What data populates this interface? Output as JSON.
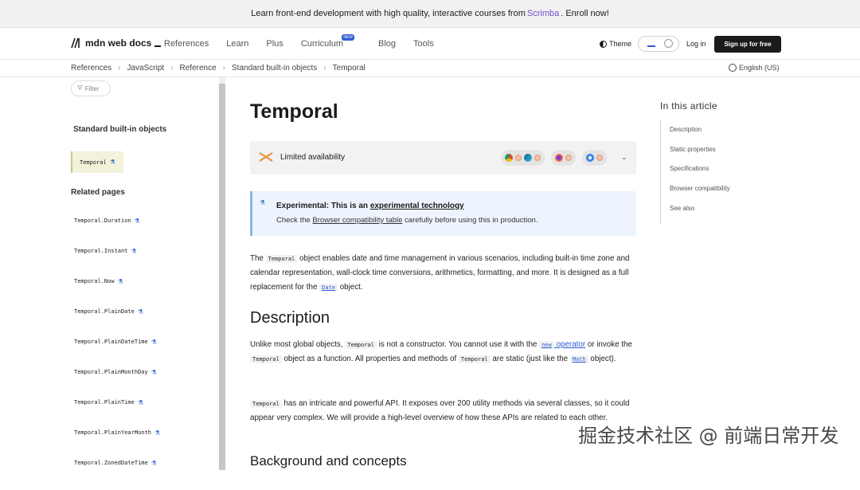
{
  "banner": {
    "text_before": "Learn front-end development with high quality, interactive courses from",
    "link": "Scrimba",
    "text_after": ". Enroll now!"
  },
  "header": {
    "logo": "mdn web docs",
    "nav": [
      "References",
      "Learn",
      "Plus",
      "Curriculum",
      "Blog",
      "Tools"
    ],
    "new_badge": "NEW",
    "theme": "Theme",
    "login": "Log in",
    "signup": "Sign up for free"
  },
  "breadcrumbs": [
    "References",
    "JavaScript",
    "Reference",
    "Standard built-in objects",
    "Temporal"
  ],
  "language": "English (US)",
  "sidebar": {
    "filter": "Filter",
    "section": "Standard built-in objects",
    "active": "Temporal",
    "related_heading": "Related pages",
    "related": [
      "Temporal.Duration",
      "Temporal.Instant",
      "Temporal.Now",
      "Temporal.PlainDate",
      "Temporal.PlainDateTime",
      "Temporal.PlainMonthDay",
      "Temporal.PlainTime",
      "Temporal.PlainYearMonth",
      "Temporal.ZonedDateTime"
    ]
  },
  "article": {
    "title": "Temporal",
    "availability": "Limited availability",
    "note": {
      "title_prefix": "Experimental: This is an ",
      "title_link": "experimental technology",
      "body_prefix": "Check the ",
      "body_link": "Browser compatibility table",
      "body_suffix": " carefully before using this in production."
    },
    "p1": {
      "a": "The ",
      "code1": "Temporal",
      "b": " object enables date and time management in various scenarios, including built-in time zone and calendar representation, wall-clock time conversions, arithmetics, formatting, and more. It is designed as a full replacement for the ",
      "code2": "Date",
      "c": " object."
    },
    "h_description": "Description",
    "p2": {
      "a": "Unlike most global objects, ",
      "code1": "Temporal",
      "b": " is not a constructor. You cannot use it with the ",
      "code2": "new",
      "link": " operator",
      "c": " or invoke the ",
      "code3": "Temporal",
      "d": " object as a function. All properties and methods of ",
      "code4": "Temporal",
      "e": " are static (just like the ",
      "code5": "Math",
      "f": " object)."
    },
    "p3": {
      "code1": "Temporal",
      "a": " has an intricate and powerful API. It exposes over 200 utility methods via several classes, so it could appear very complex. We will provide a high-level overview of how these APIs are related to each other."
    },
    "h_background": "Background and concepts"
  },
  "toc": {
    "heading": "In this article",
    "items": [
      "Description",
      "Static properties",
      "Specifications",
      "Browser compatibility",
      "See also"
    ]
  },
  "watermark": "掘金技术社区 @ 前端日常开发",
  "colors": {
    "accent": "#2f5bd3",
    "banner_link": "#6e4fcf",
    "note_bg": "#eef4fd"
  }
}
